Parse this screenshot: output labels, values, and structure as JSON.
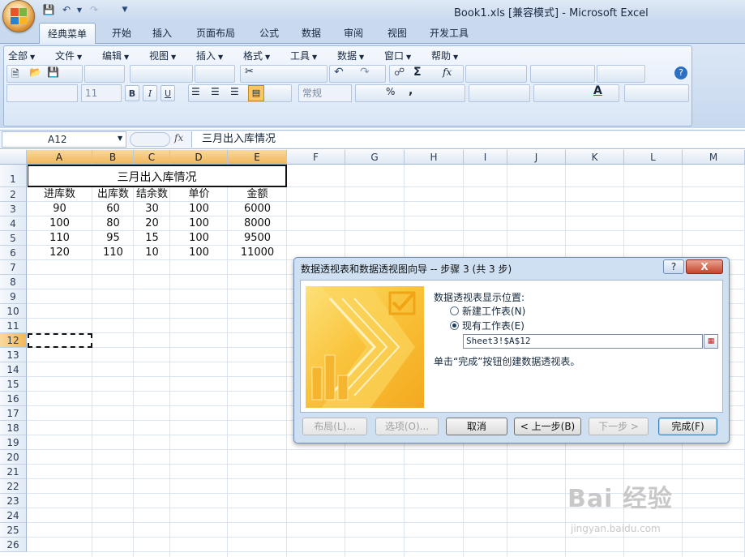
{
  "window": {
    "title": "Book1.xls  [兼容模式] - Microsoft Excel"
  },
  "tabs": [
    "经典菜单",
    "开始",
    "插入",
    "页面布局",
    "公式",
    "数据",
    "审阅",
    "视图",
    "开发工具"
  ],
  "classic_menu": [
    "全部",
    "文件",
    "编辑",
    "视图",
    "插入",
    "格式",
    "工具",
    "数据",
    "窗口",
    "帮助"
  ],
  "toolbar": {
    "font_size": "11",
    "number_format": "常规",
    "sum_symbol": "Σ",
    "fx_symbol": "fx"
  },
  "formula_bar": {
    "name_box": "A12",
    "fx": "fx",
    "content": "三月出入库情况"
  },
  "grid": {
    "columns": [
      "A",
      "B",
      "C",
      "D",
      "E",
      "F",
      "G",
      "H",
      "I",
      "J",
      "K",
      "L",
      "M"
    ],
    "rows": [
      "1",
      "2",
      "3",
      "4",
      "5",
      "6",
      "7",
      "8",
      "9",
      "10",
      "11",
      "12",
      "13",
      "14",
      "15",
      "16",
      "17",
      "18",
      "19",
      "20",
      "21",
      "22",
      "23",
      "24",
      "25",
      "26"
    ],
    "selected_cell": "A12",
    "title": "三月出入库情况",
    "headers": [
      "进库数",
      "出库数",
      "结余数",
      "单价",
      "金额"
    ],
    "data": [
      [
        "90",
        "60",
        "30",
        "100",
        "6000"
      ],
      [
        "100",
        "80",
        "20",
        "100",
        "8000"
      ],
      [
        "110",
        "95",
        "15",
        "100",
        "9500"
      ],
      [
        "120",
        "110",
        "10",
        "100",
        "11000"
      ]
    ]
  },
  "dialog": {
    "title": "数据透视表和数据透视图向导 -- 步骤 3 (共 3 步)",
    "help": "?",
    "close": "X",
    "location_label": "数据透视表显示位置:",
    "option_new": "新建工作表(N)",
    "option_existing": "现有工作表(E)",
    "existing_selected": true,
    "range_value": "Sheet3!$A$12",
    "hint": "单击“完成”按钮创建数据透视表。",
    "buttons": {
      "layout": "布局(L)...",
      "options": "选项(O)...",
      "cancel": "取消",
      "back": "< 上一步(B)",
      "next": "下一步 >",
      "finish": "完成(F)"
    }
  },
  "watermark": {
    "brand": "Bai 经验",
    "url": "jingyan.baidu.com"
  }
}
